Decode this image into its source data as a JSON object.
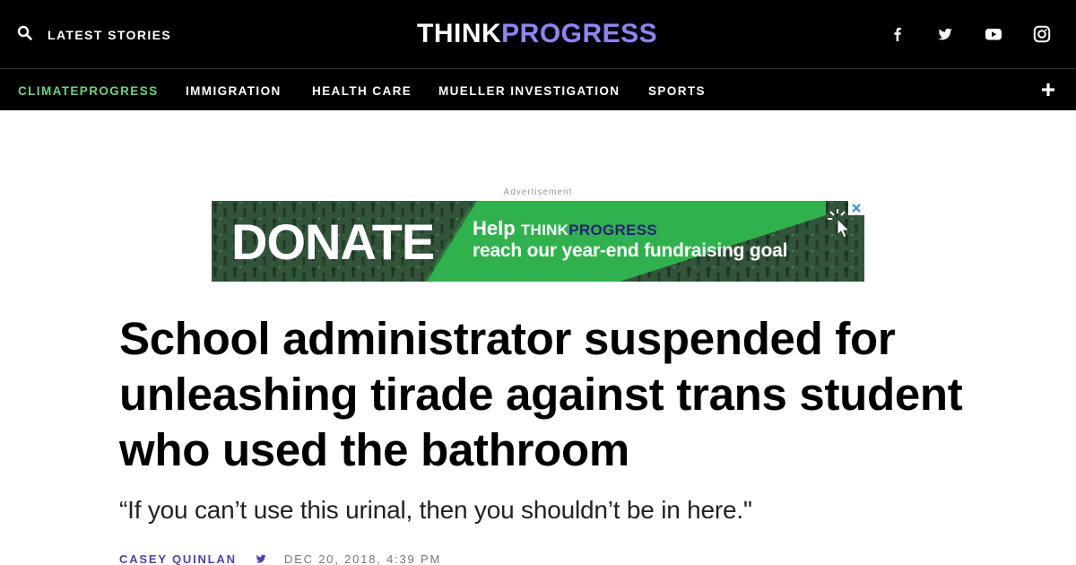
{
  "header": {
    "search_icon": "search-icon",
    "latest_label": "LATEST STORIES",
    "logo_think": "THINK",
    "logo_progress": "PROGRESS",
    "social": [
      "facebook-icon",
      "twitter-icon",
      "youtube-icon",
      "instagram-icon"
    ]
  },
  "nav": {
    "items": [
      "CLIMATEPROGRESS",
      "IMMIGRATION",
      "HEALTH CARE",
      "MUELLER INVESTIGATION",
      "SPORTS"
    ],
    "more_icon": "plus-icon"
  },
  "ad": {
    "label": "Advertisement",
    "donate": "DONATE",
    "help": "Help",
    "brand_think": "THINK",
    "brand_progress": "PROGRESS",
    "goal": "reach our year-end fundraising goal"
  },
  "article": {
    "headline": "School administrator suspended for unleashing tirade against trans student who used the bathroom",
    "dek": "“If you can’t use this urinal, then you shouldn’t be in here.\"",
    "author": "CASEY QUINLAN",
    "date": "DEC 20, 2018, 4:39 PM"
  },
  "colors": {
    "brand_purple": "#8e84f4",
    "climate_green": "#6cd47a",
    "author_purple": "#4b43b7",
    "ad_green": "#2fb24d"
  }
}
